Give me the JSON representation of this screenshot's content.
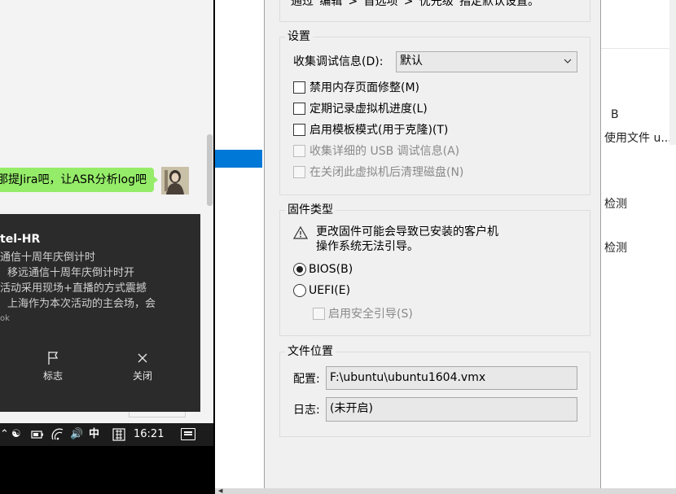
{
  "chat": {
    "message": "那提Jira吧，让ASR分析log吧"
  },
  "toast": {
    "title": "tel-HR",
    "lines": [
      "通信十周年庆倒计时",
      "移远通信十周年庆倒计时开",
      "活动采用现场+直播的方式震撼",
      "上海作为本次活动的主会场，会"
    ],
    "source": "ok",
    "actions": [
      {
        "label": "标志",
        "icon": "flag-icon"
      },
      {
        "label": "关闭",
        "icon": "close-icon"
      }
    ]
  },
  "taskbar": {
    "time": "16:21",
    "ime": "中",
    "tray_icons": [
      "chevron-up-icon",
      "qq-icon",
      "battery-icon",
      "wifi-icon",
      "volume-icon",
      "ime-icon",
      "keyboard-icon",
      "notification-icon"
    ]
  },
  "dialog": {
    "top_hint": "通过“编辑”>“首选项”>“优先级”指定默认设置。",
    "settings": {
      "title": "设置",
      "debug_label": "收集调试信息(D):",
      "debug_value": "默认",
      "options": [
        {
          "label": "禁用内存页面修整(M)",
          "checked": false,
          "enabled": true
        },
        {
          "label": "定期记录虚拟机进度(L)",
          "checked": false,
          "enabled": true
        },
        {
          "label": "启用模板模式(用于克隆)(T)",
          "checked": false,
          "enabled": true
        },
        {
          "label": "收集详细的 USB 调试信息(A)",
          "checked": false,
          "enabled": false
        },
        {
          "label": "在关闭此虚拟机后清理磁盘(N)",
          "checked": false,
          "enabled": false
        }
      ]
    },
    "firmware": {
      "title": "固件类型",
      "warning_line1": "更改固件可能会导致已安装的客户机",
      "warning_line2": "操作系统无法引导。",
      "bios_label": "BIOS(B)",
      "uefi_label": "UEFI(E)",
      "selected": "BIOS",
      "secure_boot_label": "启用安全引导(S)"
    },
    "file_location": {
      "title": "文件位置",
      "config_label": "配置:",
      "config_value": "F:\\ubuntu\\ubuntu1604.vmx",
      "log_label": "日志:",
      "log_value": "(未开启)"
    }
  },
  "right_window": {
    "lines": [
      "B",
      "使用文件 u...",
      "检测",
      "检测"
    ]
  },
  "colors": {
    "chat_bubble": "#95ec69",
    "toast_bg": "#2b2b2b",
    "selection": "#0078d7",
    "dialog_bg": "#f0f0f0"
  }
}
